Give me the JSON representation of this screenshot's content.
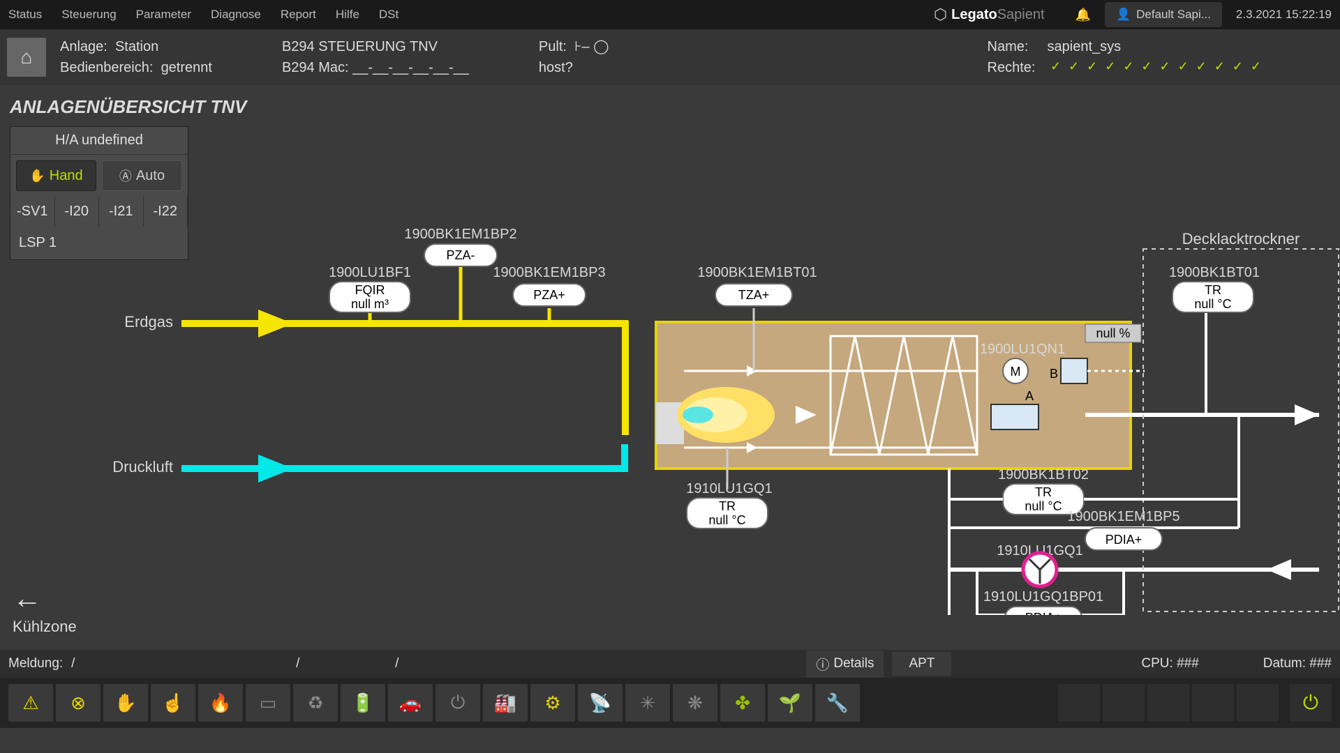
{
  "menu": {
    "items": [
      "Status",
      "Steuerung",
      "Parameter",
      "Diagnose",
      "Report",
      "Hilfe",
      "DSt"
    ]
  },
  "branding": {
    "logo1": "Legato",
    "logo2": "Sapient"
  },
  "user": {
    "label": "Default Sapi..."
  },
  "datetime": "2.3.2021  15:22:19",
  "header": {
    "anlage_k": "Anlage:",
    "anlage_v": "Station",
    "bedien_k": "Bedienbereich:",
    "bedien_v": "getrennt",
    "steuerung": "B294 STEUERUNG TNV",
    "mac": "B294 Mac: __-__-__-__-__-__",
    "pult": "Pult:",
    "pult_v": "⊦–  ◯",
    "host": "host?",
    "name_k": "Name:",
    "name_v": "sapient_sys",
    "rechte_k": "Rechte:"
  },
  "page": {
    "title": "ANLAGENÜBERSICHT TNV",
    "ha": "H/A undefined",
    "hand": "Hand",
    "auto": "Auto",
    "tabs": [
      "-SV1",
      "-I20",
      "-I21",
      "-I22"
    ],
    "lsp": "LSP 1",
    "back": "Kühlzone",
    "decklack": "Decklacktrockner"
  },
  "flows": {
    "erdgas": "Erdgas",
    "druckluft": "Druckluft"
  },
  "sensors": {
    "bp2": {
      "tag": "1900BK1EM1BP2",
      "type": "PZA-"
    },
    "bf1": {
      "tag": "1900LU1BF1",
      "type": "FQIR",
      "val": "null m³"
    },
    "bp3": {
      "tag": "1900BK1EM1BP3",
      "type": "PZA+"
    },
    "bt01": {
      "tag": "1900BK1EM1BT01",
      "type": "TZA+"
    },
    "gq1_lower": {
      "tag": "1910LU1GQ1",
      "type": "TR",
      "val": "null °C"
    },
    "bt02": {
      "tag": "1900BK1BT02",
      "type": "TR",
      "val": "null °C"
    },
    "bp5": {
      "tag": "1900BK1EM1BP5",
      "type": "PDIA+"
    },
    "gq1_right": {
      "tag": "1910LU1GQ1"
    },
    "bp01": {
      "tag": "1910LU1GQ1BP01",
      "type": "PDIA+"
    },
    "qn1": {
      "tag": "1900LU1QN1",
      "a": "A",
      "b": "B",
      "m": "M"
    },
    "bt01r": {
      "tag": "1900BK1BT01",
      "type": "TR",
      "val": "null °C"
    },
    "pct": "null %"
  },
  "status": {
    "meldung": "Meldung:",
    "s1": "/",
    "s2": "/",
    "s3": "/",
    "details": "Details",
    "apt": "APT",
    "cpu": "CPU: ###",
    "datum": "Datum: ###"
  }
}
